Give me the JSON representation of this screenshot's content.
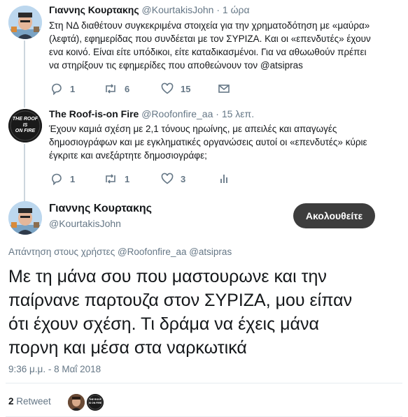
{
  "tweet1": {
    "name": "Γιαννης Κουρτακης",
    "handle": "@KourtakisJohn",
    "time": "· 1 ώρα",
    "lines": [
      "Στη ΝΔ διαθέτουν συγκεκριμένα στοιχεία για την χρηματοδότηση με «μαύρα»",
      "(λεφτά), εφημερίδας που συνδέεται με τον ΣΥΡΙΖΑ. Και οι «επενδυτές» έχουν",
      "ενα κοινό. Είναι είτε υπόδικοι, είτε καταδικασμένοι. Για να αθωωθούν πρέπει",
      "να στηρίξουν τις εφημερίδες που αποθεώνουν τον @atsipras"
    ],
    "replies": "1",
    "retweets": "6",
    "likes": "15"
  },
  "tweet2": {
    "name": "The Roof-is-on Fire",
    "handle": "@Roofonfire_aa",
    "time": "· 15 λεπ.",
    "avatar_text": [
      "THE ROOF",
      "IS",
      "ON FIRE"
    ],
    "lines": [
      "Έχουν καμιά σχέση με 2,1 τόνους ηρωίνης, με απειλές και απαγωγές",
      "δημοσιογράφων και με εγκληματικές οργανώσεις αυτοί οι «επενδυτές» κύριε",
      "έγκριτε και ανεξάρτητε δημοσιογράφε;"
    ],
    "replies": "1",
    "retweets": "1",
    "likes": "3"
  },
  "main": {
    "name": "Γιαννης Κουρτακης",
    "handle": "@KourtakisJohn",
    "follow_label": "Ακολουθείτε",
    "reply_to": "Απάντηση στους χρήστες @Roofonfire_aa @atsipras",
    "lines": [
      "Με τη μάνα σου που μαστουρωνε και την",
      "παίρνανε παρτουζα στον ΣΥΡΙΖΑ, μου είπαν",
      "ότι έχουν σχέση. Τι δράμα να έχεις μάνα",
      "πορνη και μέσα στα ναρκωτικά"
    ],
    "timestamp": "9:36 μ.μ. - 8 Μαΐ 2018",
    "retweet_count": "2",
    "retweet_label": "Retweet",
    "mini_avatar_text": "THE ROOF IS ON FIRE"
  },
  "colors": {
    "follow_bg": "#3d3d3d",
    "muted": "#657786",
    "text": "#14171a",
    "thread_line": "#ccd6dd"
  }
}
